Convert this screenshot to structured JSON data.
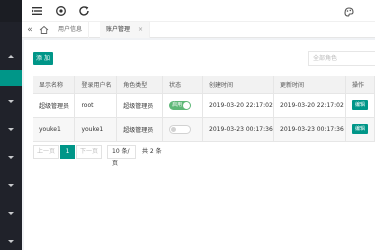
{
  "header": {
    "icons": [
      "menu-fold-icon",
      "globe-icon",
      "refresh-icon",
      "theme-icon"
    ]
  },
  "tabbar": {
    "prev_icon": "«",
    "tabs": [
      {
        "label": "用户信息",
        "active": false
      },
      {
        "label": "账户管理",
        "active": true
      }
    ],
    "close_icon": "×"
  },
  "toolbar": {
    "add_label": "添 加",
    "search_placeholder": "全部角色"
  },
  "table": {
    "columns": [
      "显示名称",
      "登录用户名",
      "角色类型",
      "状态",
      "创建时间",
      "更新时间",
      "操作"
    ],
    "rows": [
      {
        "display_name": "超级管理员",
        "login_name": "root",
        "role": "超级管理员",
        "status": "启用",
        "created": "2019-03-20 22:17:02",
        "updated": "2019-03-20 22:17:02",
        "action": "编辑"
      },
      {
        "display_name": "youke1",
        "login_name": "youke1",
        "role": "超级管理员",
        "status": "",
        "created": "2019-03-23 00:17:36",
        "updated": "2019-03-23 00:17:36",
        "action": "编辑"
      }
    ]
  },
  "pager": {
    "prev": "上一页",
    "current": "1",
    "next": "下一页",
    "size": "10 条/页",
    "total": "共 2 条"
  },
  "colors": {
    "accent": "#009688",
    "switch_on": "#5fb878",
    "sidebar": "#20222a"
  }
}
